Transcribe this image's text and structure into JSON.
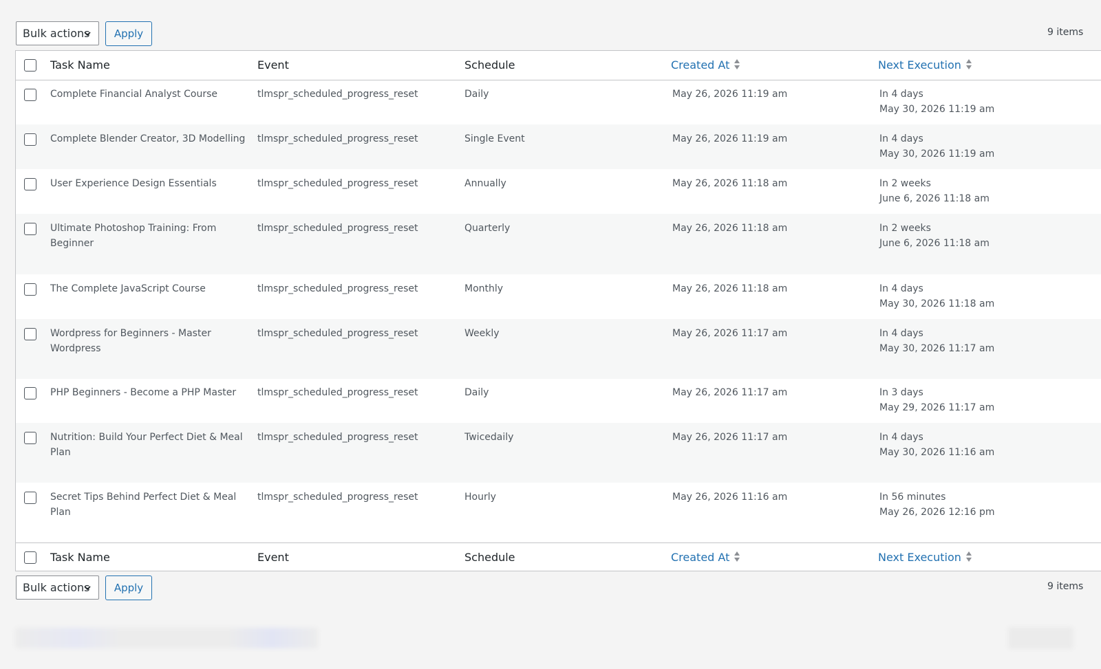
{
  "toolbar": {
    "bulk_actions_label": "Bulk actions",
    "apply_label": "Apply",
    "items_count": "9 items"
  },
  "table": {
    "columns": {
      "task_name": "Task Name",
      "event": "Event",
      "schedule": "Schedule",
      "created_at": "Created At",
      "next_execution": "Next Execution"
    },
    "rows": [
      {
        "name": "Complete Financial Analyst Course",
        "event": "tlmspr_scheduled_progress_reset",
        "schedule": "Daily",
        "created_at": "May 26, 2026 11:19 am",
        "next_relative": "In 4 days",
        "next_date": "May 30, 2026 11:19 am"
      },
      {
        "name": "Complete Blender Creator, 3D Modelling",
        "event": "tlmspr_scheduled_progress_reset",
        "schedule": "Single Event",
        "created_at": "May 26, 2026 11:19 am",
        "next_relative": "In 4 days",
        "next_date": "May 30, 2026 11:19 am"
      },
      {
        "name": "User Experience Design Essentials",
        "event": "tlmspr_scheduled_progress_reset",
        "schedule": "Annually",
        "created_at": "May 26, 2026 11:18 am",
        "next_relative": "In 2 weeks",
        "next_date": "June 6, 2026 11:18 am"
      },
      {
        "name": "Ultimate Photoshop Training: From Beginner",
        "event": "tlmspr_scheduled_progress_reset",
        "schedule": "Quarterly",
        "created_at": "May 26, 2026 11:18 am",
        "next_relative": "In 2 weeks",
        "next_date": "June 6, 2026 11:18 am"
      },
      {
        "name": "The Complete JavaScript Course",
        "event": "tlmspr_scheduled_progress_reset",
        "schedule": "Monthly",
        "created_at": "May 26, 2026 11:18 am",
        "next_relative": "In 4 days",
        "next_date": "May 30, 2026 11:18 am"
      },
      {
        "name": "Wordpress for Beginners - Master Wordpress",
        "event": "tlmspr_scheduled_progress_reset",
        "schedule": "Weekly",
        "created_at": "May 26, 2026 11:17 am",
        "next_relative": "In 4 days",
        "next_date": "May 30, 2026 11:17 am"
      },
      {
        "name": "PHP Beginners - Become a PHP Master",
        "event": "tlmspr_scheduled_progress_reset",
        "schedule": "Daily",
        "created_at": "May 26, 2026 11:17 am",
        "next_relative": "In 3 days",
        "next_date": "May 29, 2026 11:17 am"
      },
      {
        "name": "Nutrition: Build Your Perfect Diet & Meal Plan",
        "event": "tlmspr_scheduled_progress_reset",
        "schedule": "Twicedaily",
        "created_at": "May 26, 2026 11:17 am",
        "next_relative": "In 4 days",
        "next_date": "May 30, 2026 11:16 am"
      },
      {
        "name": "Secret Tips Behind Perfect Diet & Meal Plan",
        "event": "tlmspr_scheduled_progress_reset",
        "schedule": "Hourly",
        "created_at": "May 26, 2026 11:16 am",
        "next_relative": "In 56 minutes",
        "next_date": "May 26, 2026 12:16 pm"
      }
    ]
  },
  "colors": {
    "link": "#2271b1",
    "alt_row": "#f6f7f7",
    "border": "#c3c4c7"
  }
}
